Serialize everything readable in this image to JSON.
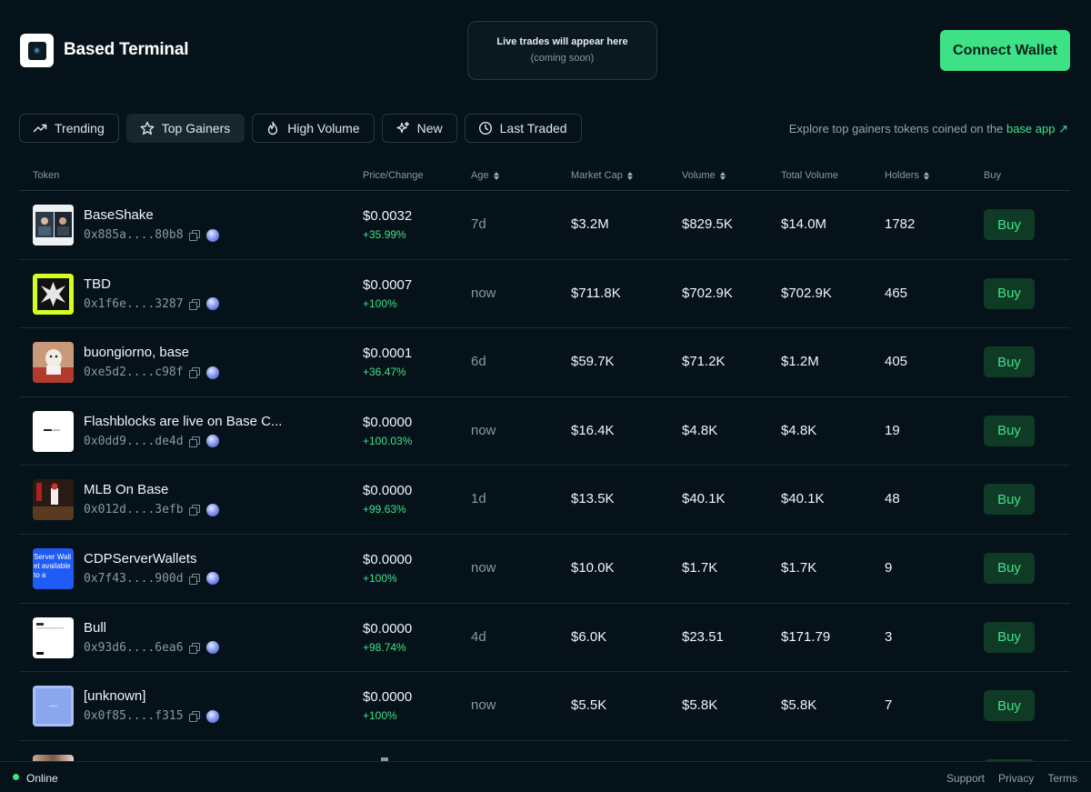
{
  "header": {
    "brand": "Based Terminal",
    "live_title": "Live trades will appear here",
    "live_sub": "(coming soon)",
    "connect_label": "Connect Wallet"
  },
  "tabs": [
    {
      "label": "Trending",
      "icon": "trending-up-icon"
    },
    {
      "label": "Top Gainers",
      "icon": "star-icon",
      "active": true
    },
    {
      "label": "High Volume",
      "icon": "flame-icon"
    },
    {
      "label": "New",
      "icon": "sparkles-icon"
    },
    {
      "label": "Last Traded",
      "icon": "clock-icon"
    }
  ],
  "explore": {
    "prefix": "Explore top gainers tokens coined on the",
    "link": "base app",
    "arrow": "↗"
  },
  "columns": {
    "token": "Token",
    "price_change": "Price/Change",
    "age": "Age",
    "market_cap": "Market Cap",
    "volume": "Volume",
    "total_volume": "Total Volume",
    "holders": "Holders",
    "buy": "Buy"
  },
  "rows": [
    {
      "name": "BaseShake",
      "addr": "0x885a....80b8",
      "price": "$0.0032",
      "change": "+35.99%",
      "age": "7d",
      "mcap": "$3.2M",
      "volume": "$829.5K",
      "total": "$14.0M",
      "holders": "1782",
      "buy": "Buy"
    },
    {
      "name": "TBD",
      "addr": "0x1f6e....3287",
      "price": "$0.0007",
      "change": "+100%",
      "age": "now",
      "mcap": "$711.8K",
      "volume": "$702.9K",
      "total": "$702.9K",
      "holders": "465",
      "buy": "Buy"
    },
    {
      "name": "buongiorno, base",
      "addr": "0xe5d2....c98f",
      "price": "$0.0001",
      "change": "+36.47%",
      "age": "6d",
      "mcap": "$59.7K",
      "volume": "$71.2K",
      "total": "$1.2M",
      "holders": "405",
      "buy": "Buy"
    },
    {
      "name": "Flashblocks are live on Base C...",
      "addr": "0x0dd9....de4d",
      "price": "$0.0000",
      "change": "+100.03%",
      "age": "now",
      "mcap": "$16.4K",
      "volume": "$4.8K",
      "total": "$4.8K",
      "holders": "19",
      "buy": "Buy"
    },
    {
      "name": "MLB On Base",
      "addr": "0x012d....3efb",
      "price": "$0.0000",
      "change": "+99.63%",
      "age": "1d",
      "mcap": "$13.5K",
      "volume": "$40.1K",
      "total": "$40.1K",
      "holders": "48",
      "buy": "Buy"
    },
    {
      "name": "CDPServerWallets",
      "addr": "0x7f43....900d",
      "price": "$0.0000",
      "change": "+100%",
      "age": "now",
      "mcap": "$10.0K",
      "volume": "$1.7K",
      "total": "$1.7K",
      "holders": "9",
      "buy": "Buy"
    },
    {
      "name": "Bull",
      "addr": "0x93d6....6ea6",
      "price": "$0.0000",
      "change": "+98.74%",
      "age": "4d",
      "mcap": "$6.0K",
      "volume": "$23.51",
      "total": "$171.79",
      "holders": "3",
      "buy": "Buy"
    },
    {
      "name": "[unknown]",
      "addr": "0x0f85....f315",
      "price": "$0.0000",
      "change": "+100%",
      "age": "now",
      "mcap": "$5.5K",
      "volume": "$5.8K",
      "total": "$5.8K",
      "holders": "7",
      "buy": "Buy"
    }
  ],
  "thumb_images": {
    "thumb_5_text": "Server Wallet available to a"
  },
  "footer": {
    "status": "Online",
    "links": [
      "Support",
      "Privacy",
      "Terms"
    ]
  },
  "colors": {
    "background": "#05121a",
    "accent": "#3ee286",
    "buy_bg": "#0f3a26"
  }
}
